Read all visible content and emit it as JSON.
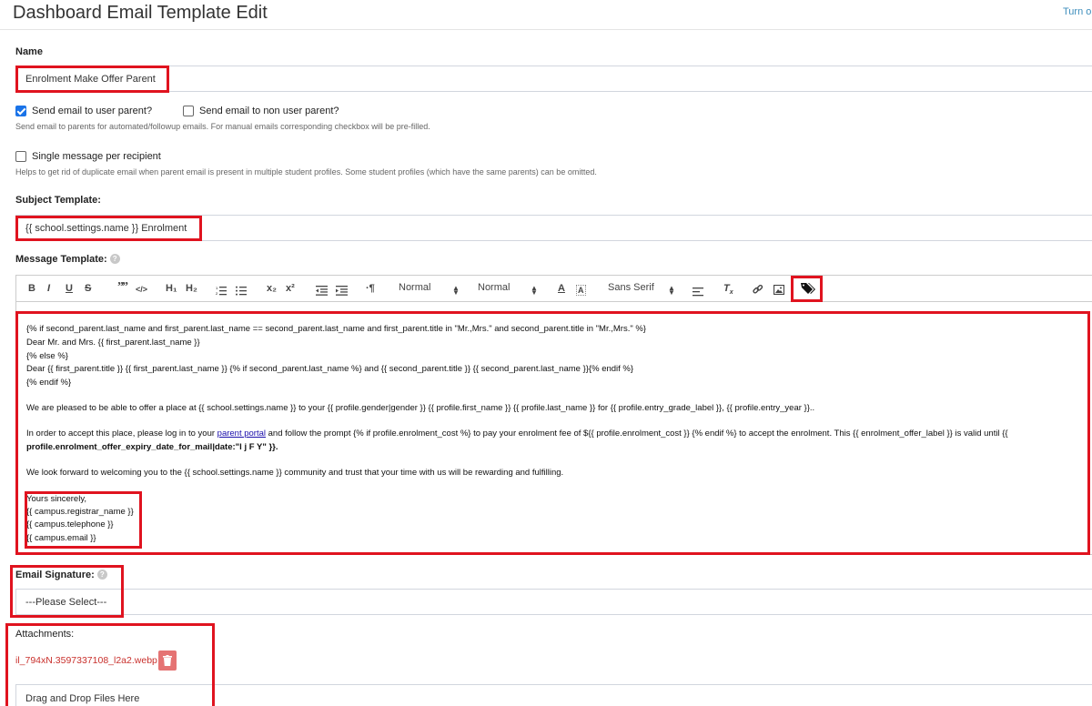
{
  "header": {
    "title": "Dashboard Email Template Edit",
    "turn_link": "Turn o"
  },
  "name": {
    "label": "Name",
    "value": "Enrolment Make Offer Parent"
  },
  "options": {
    "send_user_parent": "Send email to user parent?",
    "send_non_user_parent": "Send email to non user parent?",
    "send_help": "Send email to parents for automated/followup emails. For manual emails corresponding checkbox will be pre-filled.",
    "single_message": "Single message per recipient",
    "single_help": "Helps to get rid of duplicate email when parent email is present in multiple student profiles. Some student profiles (which have the same parents) can be omitted."
  },
  "subject": {
    "label": "Subject Template:",
    "value": "{{ school.settings.name }} Enrolment"
  },
  "message": {
    "label": "Message Template:",
    "help_icon": "question-circle-icon",
    "toolbar": {
      "bold": "B",
      "italic": "I",
      "underline": "U",
      "strike": "S",
      "quote": "”",
      "code": "</>",
      "h1": "H₁",
      "h2": "H₂",
      "ordered_list": "ordered-list-icon",
      "bullet_list": "bullet-list-icon",
      "subscript": "x₂",
      "superscript": "x²",
      "outdent": "outdent-icon",
      "indent": "indent-icon",
      "rtl": "·¶",
      "size": "Normal",
      "header": "Normal",
      "color": "A",
      "background": "A",
      "font": "Sans Serif",
      "align": "align-icon",
      "clean": "T",
      "clean_sub": "x",
      "link": "link-icon",
      "image": "image-icon",
      "tags": "tags-icon"
    },
    "lines": [
      "{% if second_parent.last_name and first_parent.last_name == second_parent.last_name and first_parent.title in \"Mr.,Mrs.\" and second_parent.title in \"Mr.,Mrs.\" %}",
      "Dear Mr. and Mrs. {{ first_parent.last_name }}",
      "{% else %}",
      "Dear {{ first_parent.title }} {{ first_parent.last_name }} {% if second_parent.last_name %} and {{ second_parent.title }} {{ second_parent.last_name }}{% endif %}",
      "{% endif %}",
      "We are pleased to be able to offer a place at {{ school.settings.name }} to your {{ profile.gender|gender }} {{ profile.first_name }} {{ profile.last_name }} for {{ profile.entry_grade_label }}, {{ profile.entry_year }}..",
      "In order to accept this place, please log in to your ",
      "parent portal",
      " and follow the prompt {% if profile.enrolment_cost %} to pay your enrolment fee of ${{ profile.enrolment_cost }} {% endif %} to accept the enrolment. This {{ enrolment_offer_label }} is valid until {{",
      "profile.enrolment_offer_expiry_date_for_mail|date:\"l j F Y\" }}.",
      "We look forward to welcoming you to the {{ school.settings.name }} community and trust that your time with us will be rewarding and fulfilling.",
      "Yours sincerely,",
      "{{ campus.registrar_name }}",
      "{{ campus.telephone }}",
      "{{ campus.email }}"
    ]
  },
  "signature": {
    "label": "Email Signature:",
    "help_icon": "question-circle-icon",
    "value": "---Please Select---"
  },
  "attachments": {
    "label": "Attachments:",
    "file_name": "il_794xN.3597337108_l2a2.webp",
    "delete_icon": "trash-icon",
    "drop_text": "Drag and Drop Files Here"
  },
  "colors": {
    "highlight": "#e0131f",
    "checkbox": "#1a73e8",
    "link": "#1a0dab",
    "attachment": "#c9302c"
  }
}
